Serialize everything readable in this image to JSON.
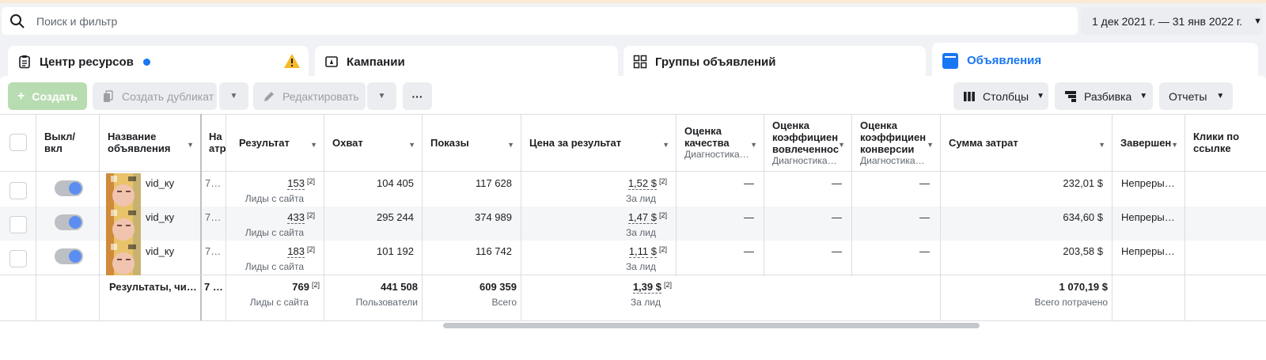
{
  "search": {
    "placeholder": "Поиск и фильтр"
  },
  "date_range": "1 дек 2021 г. — 31 янв 2022 г.",
  "tabs": [
    {
      "label": "Центр ресурсов"
    },
    {
      "label": "Кампании"
    },
    {
      "label": "Группы объявлений"
    },
    {
      "label": "Объявления"
    }
  ],
  "toolbar": {
    "create": "Создать",
    "duplicate": "Создать дубликат",
    "edit": "Редактировать",
    "more": "···",
    "columns": "Столбцы",
    "breakdown": "Разбивка",
    "reports": "Отчеты"
  },
  "columns": {
    "onoff": "Выкл/ вкл",
    "name": "Название объявления",
    "na": "На атр",
    "result": "Результат",
    "reach": "Охват",
    "impressions": "Показы",
    "cost": "Цена за результат",
    "quality": "Оценка качества",
    "quality_sub": "Диагностика…",
    "engagement": "Оценка коэффициен вовлеченнос",
    "engagement_sub": "Диагностика…",
    "conversion": "Оценка коэффициен конверсии",
    "conversion_sub": "Диагностика…",
    "spent": "Сумма затрат",
    "ends": "Завершен",
    "clicks": "Клики по ссылке"
  },
  "rows": [
    {
      "name": "vid_ку",
      "na": "7…",
      "result": "153",
      "result_sub": "Лиды с сайта",
      "reach": "104 405",
      "impressions": "117 628",
      "cost": "1,52 $",
      "cost_sub": "За лид",
      "quality": "—",
      "engagement": "—",
      "conversion": "—",
      "spent": "232,01 $",
      "ends": "Непреры…",
      "sup": "[2]"
    },
    {
      "name": "vid_ку",
      "na": "7…",
      "result": "433",
      "result_sub": "Лиды с сайта",
      "reach": "295 244",
      "impressions": "374 989",
      "cost": "1,47 $",
      "cost_sub": "За лид",
      "quality": "—",
      "engagement": "—",
      "conversion": "—",
      "spent": "634,60 $",
      "ends": "Непреры…",
      "sup": "[2]"
    },
    {
      "name": "vid_ку",
      "na": "7…",
      "result": "183",
      "result_sub": "Лиды с сайта",
      "reach": "101 192",
      "impressions": "116 742",
      "cost": "1,11 $",
      "cost_sub": "За лид",
      "quality": "—",
      "engagement": "—",
      "conversion": "—",
      "spent": "203,58 $",
      "ends": "Непреры…",
      "sup": "[2]"
    }
  ],
  "totals": {
    "label": "Результаты, чи…",
    "na": "7 …",
    "result": "769",
    "result_sub": "Лиды с сайта",
    "reach": "441 508",
    "reach_sub": "Пользователи",
    "impressions": "609 359",
    "impressions_sub": "Всего",
    "cost": "1,39 $",
    "cost_sub": "За лид",
    "spent": "1 070,19 $",
    "spent_sub": "Всего потрачено",
    "sup": "[2]"
  },
  "colors": {
    "accent": "#1877f2",
    "create_button": "#b8dcb1",
    "warning": "#f7b928"
  }
}
